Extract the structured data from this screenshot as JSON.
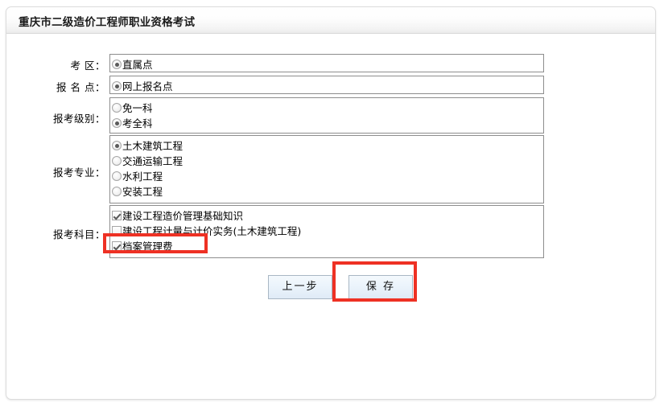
{
  "panel": {
    "title": "重庆市二级造价工程师职业资格考试"
  },
  "form": {
    "rows": [
      {
        "label": "考 区：",
        "name": "exam-area",
        "type": "radio",
        "options": [
          {
            "label": "直属点",
            "checked": true
          }
        ]
      },
      {
        "label": "报 名 点：",
        "name": "registration-point",
        "type": "radio",
        "options": [
          {
            "label": "网上报名点",
            "checked": true
          }
        ]
      },
      {
        "label": "报考级别：",
        "name": "exam-level",
        "type": "radio",
        "options": [
          {
            "label": "免一科",
            "checked": false
          },
          {
            "label": "考全科",
            "checked": true
          }
        ]
      },
      {
        "label": "报考专业：",
        "name": "exam-major",
        "type": "radio",
        "options": [
          {
            "label": "土木建筑工程",
            "checked": true
          },
          {
            "label": "交通运输工程",
            "checked": false
          },
          {
            "label": "水利工程",
            "checked": false
          },
          {
            "label": "安装工程",
            "checked": false
          }
        ]
      },
      {
        "label": "报考科目：",
        "name": "exam-subjects",
        "type": "checkbox",
        "options": [
          {
            "label": "建设工程造价管理基础知识",
            "checked": true
          },
          {
            "label": "建设工程计量与计价实务(土木建筑工程)",
            "checked": false
          },
          {
            "label": "档案管理费",
            "checked": true
          }
        ]
      }
    ]
  },
  "actions": {
    "prev_label": "上一步",
    "save_label": "保 存"
  },
  "annotations": {
    "highlight_color": "#ee3124",
    "items": [
      {
        "name": "archive-fee-highlight",
        "target": "档案管理费"
      },
      {
        "name": "save-button-highlight",
        "target": "保 存"
      }
    ]
  }
}
